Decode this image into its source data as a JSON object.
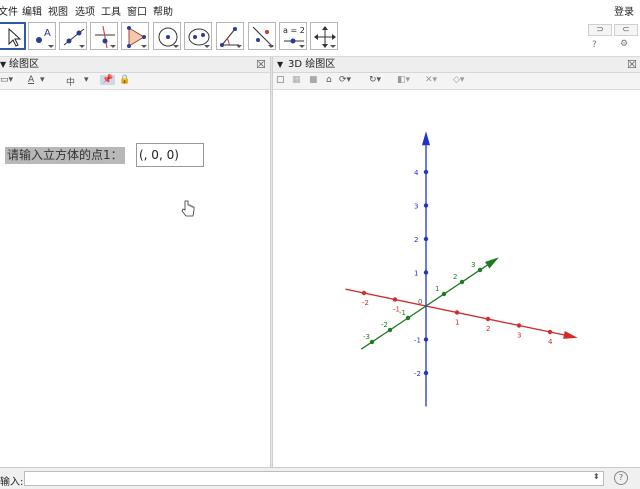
{
  "menu": {
    "items": [
      "文件",
      "编辑",
      "视图",
      "选项",
      "工具",
      "窗口",
      "帮助"
    ],
    "login": "登录"
  },
  "toolbar": {
    "tools": [
      "move-tool",
      "point-tool",
      "line-tool",
      "perpendicular-line-tool",
      "polygon-tool",
      "circle-center-tool",
      "ellipse-tool",
      "angle-tool",
      "reflect-tool",
      "slider-tool",
      "move-graphics-view-tool"
    ],
    "slider_label": "a = 2",
    "undo_glyph": "⊃",
    "redo_glyph": "⊂",
    "help_glyph": "?",
    "settings_glyph": "⚙"
  },
  "left_panel": {
    "title": "绘图区",
    "style_bar": {
      "font_size_glyph": "A",
      "text_size": "中"
    },
    "prompt_label": "请输入立方体的点1：",
    "prompt_value": "(, 0, 0)"
  },
  "right_panel": {
    "title": "3D 绘图区"
  },
  "input_bar": {
    "label": "输入:",
    "value": "",
    "help_glyph": "?",
    "spin_glyph": "⬍"
  },
  "axes3d": {
    "x_ticks": [
      "-2",
      "-1",
      "0",
      "1",
      "2",
      "3",
      "4"
    ],
    "y_ticks": [
      "-3",
      "-2",
      "-1",
      "1",
      "2",
      "3"
    ],
    "z_ticks": [
      "4",
      "3",
      "2",
      "1",
      "-1",
      "-2"
    ],
    "origin_label": "0",
    "colors": {
      "x": "#d42a2a",
      "y": "#1f7a1f",
      "z": "#2233cc"
    }
  }
}
